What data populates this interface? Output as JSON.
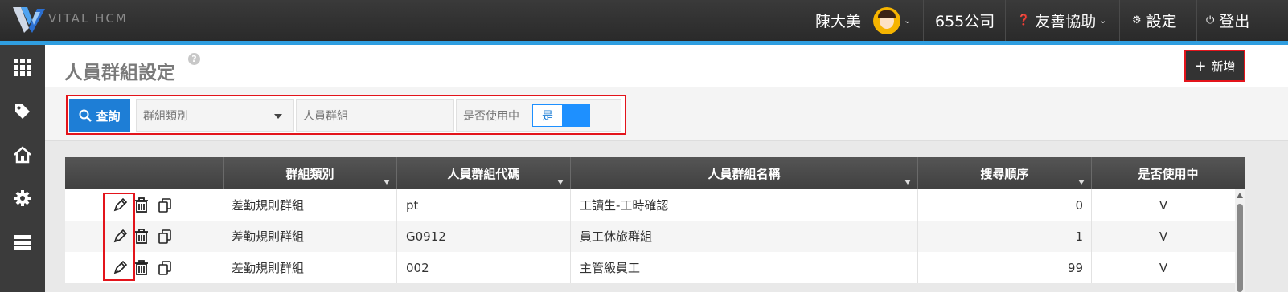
{
  "app": {
    "logo_text": "VITAL HCM"
  },
  "topbar": {
    "user_name": "陳大美",
    "company": "655公司",
    "help": "友善協助",
    "settings": "設定",
    "logout": "登出"
  },
  "page": {
    "title": "人員群組設定",
    "help_glyph": "?",
    "add_label": "新增",
    "add_glyph": "+"
  },
  "filter": {
    "query_label": "查詢",
    "group_type_placeholder": "群組類別",
    "group_name_placeholder": "人員群組",
    "in_use_label": "是否使用中",
    "in_use_value": "是"
  },
  "table": {
    "headers": [
      "群組類別",
      "人員群組代碼",
      "人員群組名稱",
      "搜尋順序",
      "是否使用中"
    ],
    "rows": [
      {
        "type": "差勤規則群組",
        "code": "pt",
        "name": "工讀生-工時確認",
        "order": "0",
        "active": "V"
      },
      {
        "type": "差勤規則群組",
        "code": "G0912",
        "name": "員工休旅群組",
        "order": "1",
        "active": "V"
      },
      {
        "type": "差勤規則群組",
        "code": "002",
        "name": "主管級員工",
        "order": "99",
        "active": "V"
      }
    ]
  },
  "colors": {
    "accent": "#2f9ee0",
    "query_button": "#1e7ed6",
    "highlight": "#e3141b",
    "header_bg": "#404040"
  }
}
